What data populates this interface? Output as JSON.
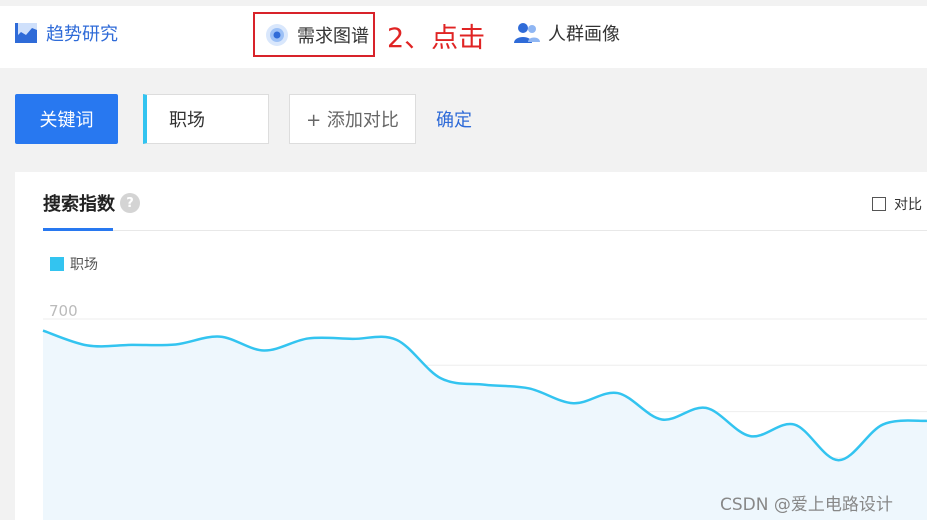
{
  "nav": {
    "trend_label": "趋势研究",
    "demand_label": "需求图谱",
    "people_label": "人群画像",
    "annotation": "2、点击"
  },
  "search": {
    "keyword_button": "关键词",
    "keyword_value": "职场",
    "add_compare": "+ 添加对比",
    "confirm": "确定"
  },
  "panel": {
    "tab_label": "搜索指数",
    "help_icon": "?",
    "compare_checkbox": "对比",
    "legend_label": "职场"
  },
  "colors": {
    "accent": "#2878f0",
    "series": "#33c4f0",
    "highlight": "#d8232a"
  },
  "chart_data": {
    "type": "area",
    "series": [
      {
        "name": "职场",
        "values": [
          675,
          643,
          644,
          645,
          662,
          632,
          658,
          657,
          655,
          572,
          558,
          550,
          518,
          540,
          483,
          508,
          447,
          472,
          395,
          472,
          480
        ]
      }
    ],
    "yticks": [
      "700",
      "600",
      "500",
      "400",
      "300"
    ],
    "ylim": [
      265,
      700
    ]
  },
  "watermark": "CSDN @爱上电路设计"
}
